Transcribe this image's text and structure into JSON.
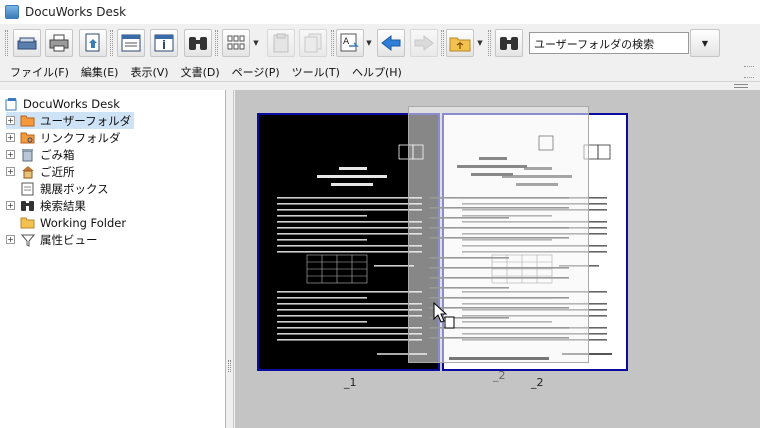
{
  "app": {
    "title": "DocuWorks Desk"
  },
  "toolbar": {
    "buttons": [
      {
        "icon": "scanner-icon",
        "enabled": true
      },
      {
        "icon": "printer-icon",
        "enabled": true
      },
      {
        "icon": "document-convert-icon",
        "enabled": true
      },
      {
        "icon": "viewer-window-icon",
        "enabled": true
      },
      {
        "icon": "properties-icon",
        "enabled": true
      },
      {
        "icon": "binoculars-icon",
        "enabled": true
      },
      {
        "icon": "grid-view-icon",
        "enabled": true
      },
      {
        "icon": "paste-icon",
        "enabled": false
      },
      {
        "icon": "copy-pages-icon",
        "enabled": false
      },
      {
        "icon": "text-convert-icon",
        "enabled": true
      },
      {
        "icon": "back-arrow-icon",
        "enabled": true
      },
      {
        "icon": "forward-arrow-icon",
        "enabled": false
      },
      {
        "icon": "folder-up-icon",
        "enabled": true
      },
      {
        "icon": "search-binoculars-icon",
        "enabled": true
      }
    ],
    "search_value": "ユーザーフォルダの検索"
  },
  "menu": {
    "items": [
      "ファイル(F)",
      "編集(E)",
      "表示(V)",
      "文書(D)",
      "ページ(P)",
      "ツール(T)",
      "ヘルプ(H)"
    ]
  },
  "tree": {
    "root": "DocuWorks Desk",
    "items": [
      {
        "label": "ユーザーフォルダ",
        "icon": "user-folder-icon",
        "expander": "+"
      },
      {
        "label": "リンクフォルダ",
        "icon": "link-folder-icon",
        "expander": "+"
      },
      {
        "label": "ごみ箱",
        "icon": "trash-icon",
        "expander": "+"
      },
      {
        "label": "ご近所",
        "icon": "neighborhood-icon",
        "expander": "+"
      },
      {
        "label": "親展ボックス",
        "icon": "confidential-box-icon",
        "expander": ""
      },
      {
        "label": "検索結果",
        "icon": "search-results-icon",
        "expander": "+"
      },
      {
        "label": "Working Folder",
        "icon": "working-folder-icon",
        "expander": ""
      },
      {
        "label": "属性ビュー",
        "icon": "filter-icon",
        "expander": "+"
      }
    ]
  },
  "content": {
    "pages": [
      {
        "label": "_1",
        "style": "inverted"
      },
      {
        "label": "_2",
        "style": "normal"
      }
    ],
    "ghost_label": "_2"
  },
  "colors": {
    "page_border": "#0b0b9e",
    "content_bg": "#c4c4c4",
    "selection": "#cfe3f7"
  }
}
